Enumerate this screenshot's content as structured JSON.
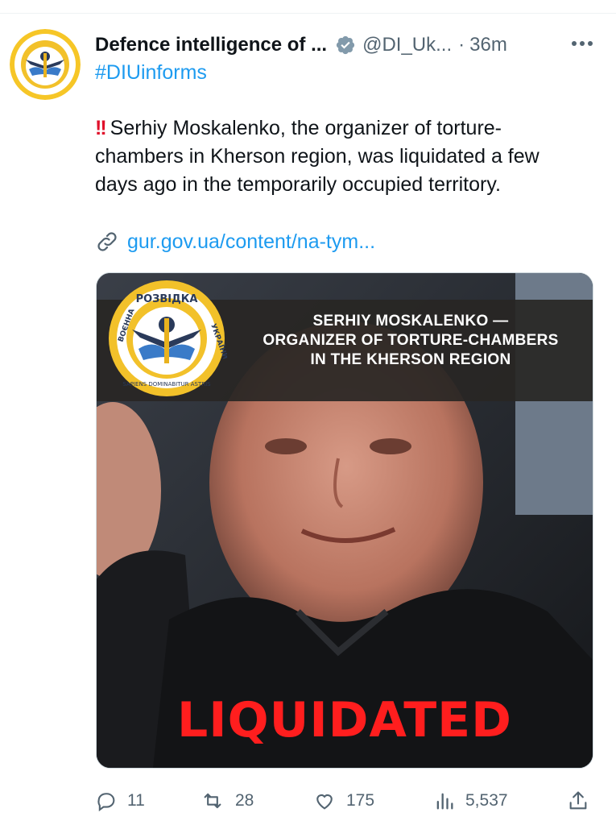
{
  "tweet": {
    "author_name": "Defence intelligence of ...",
    "handle": "@DI_Uk...",
    "separator": "·",
    "time": "36m",
    "hashtag": "#DIUinforms",
    "alert_glyph": "!!",
    "text": "Serhiy Moskalenko, the organizer of torture-chambers in Kherson region, was liquidated a few days ago in the temporarily occupied territory.",
    "link": "gur.gov.ua/content/na-tym...",
    "verified_color": "#829aab"
  },
  "media": {
    "banner_lines": [
      "SERHIY MOSKALENKO —",
      "ORGANIZER OF TORTURE-CHAMBERS",
      "IN THE KHERSON REGION"
    ],
    "stamp": "LIQUIDATED",
    "emblem_top_text": "РОЗВІДКА",
    "emblem_left_text": "ВОЄННА",
    "emblem_right_text": "УКРАЇНИ",
    "emblem_bottom_text": "SAPIENS DOMINABITUR ASTRIS"
  },
  "actions": {
    "replies": "11",
    "retweets": "28",
    "likes": "175",
    "views": "5,537"
  },
  "icons": {
    "verified": "verified-badge-icon",
    "more": "more-icon",
    "link": "link-icon",
    "reply": "reply-icon",
    "retweet": "retweet-icon",
    "like": "heart-icon",
    "views": "views-icon",
    "share": "share-icon"
  }
}
